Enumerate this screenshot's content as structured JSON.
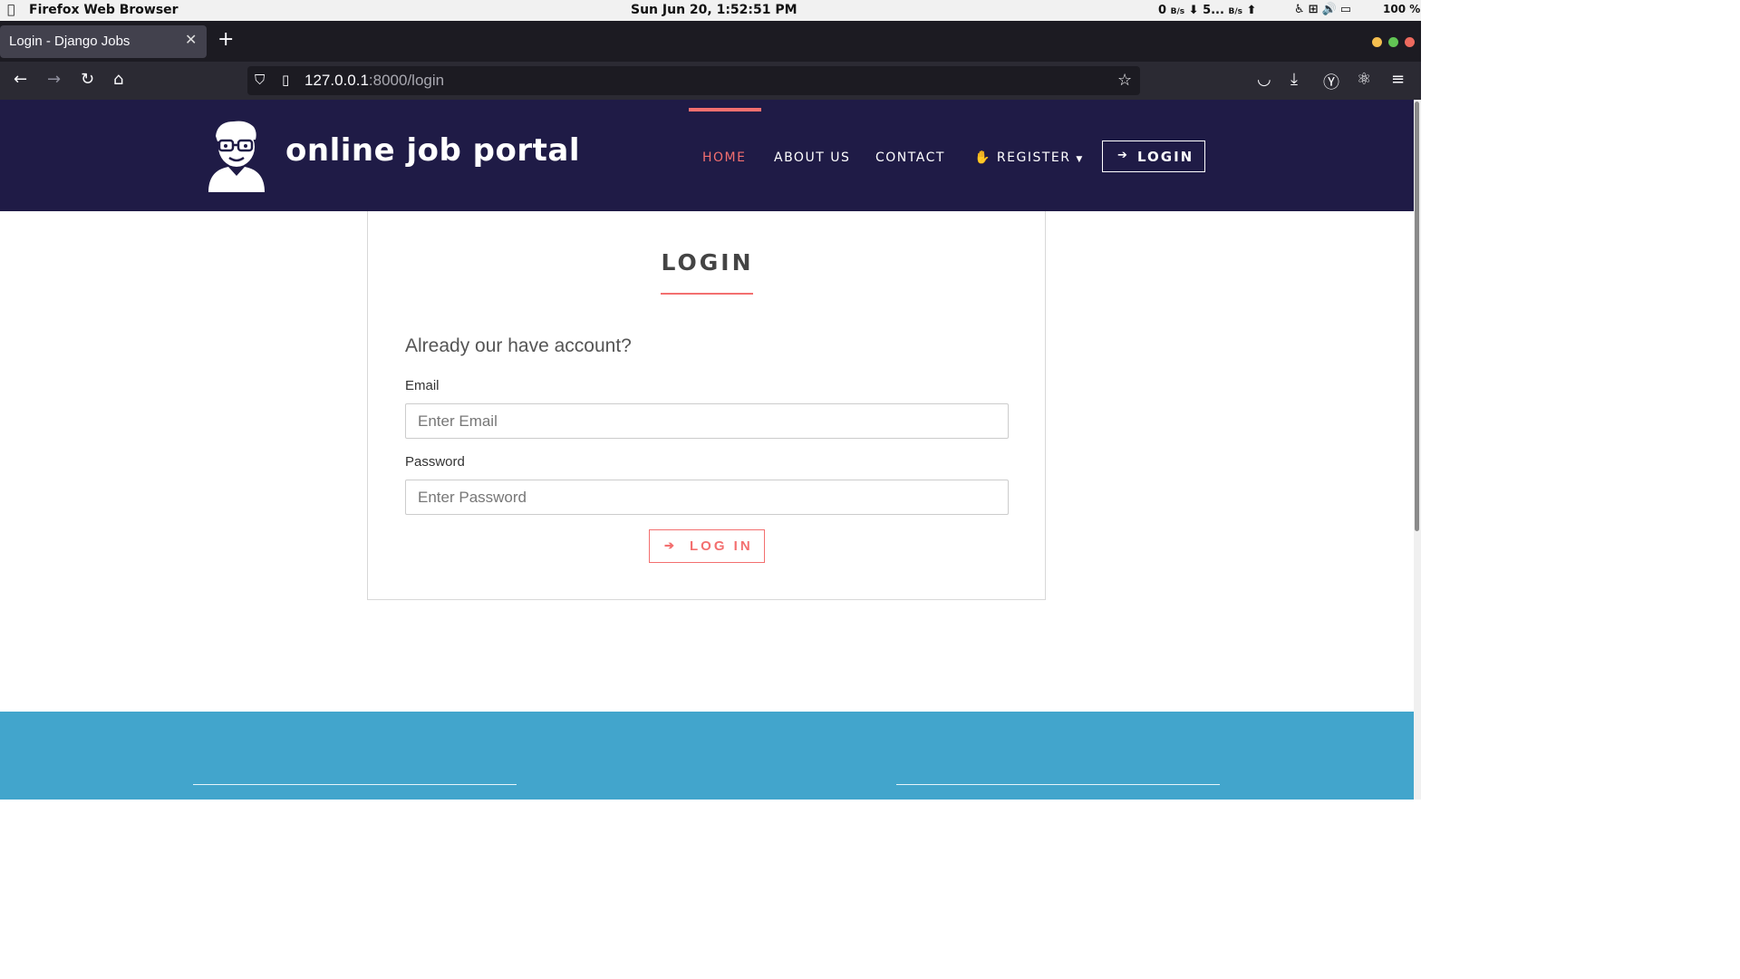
{
  "system_bar": {
    "app_name": "Firefox Web Browser",
    "clock": "Sun Jun 20,  1:52:51 PM",
    "net_down": "0",
    "net_down_unit": "B/s",
    "net_up": "5...",
    "net_up_unit": "B/s",
    "battery": "100 %"
  },
  "browser": {
    "tab_title": "Login - Django Jobs",
    "url_host": "127.0.0.1",
    "url_rest": ":8000/login",
    "window_colors": {
      "minimize": "#f5bf4f",
      "maximize": "#62c554",
      "close": "#ed6a5e"
    }
  },
  "header": {
    "brand": "online job portal",
    "nav": {
      "home": "HOME",
      "about": "ABOUT US",
      "contact": "CONTACT",
      "register": "REGISTER",
      "login": "LOGIN"
    },
    "colors": {
      "background": "#1f1b46",
      "accent": "#f36f6f"
    }
  },
  "login_form": {
    "title": "LOGIN",
    "subtitle": "Already our have account?",
    "email_label": "Email",
    "email_placeholder": "Enter Email",
    "password_label": "Password",
    "password_placeholder": "Enter Password",
    "submit_label": "LOG IN"
  },
  "footer": {
    "color": "#42a5cc"
  }
}
